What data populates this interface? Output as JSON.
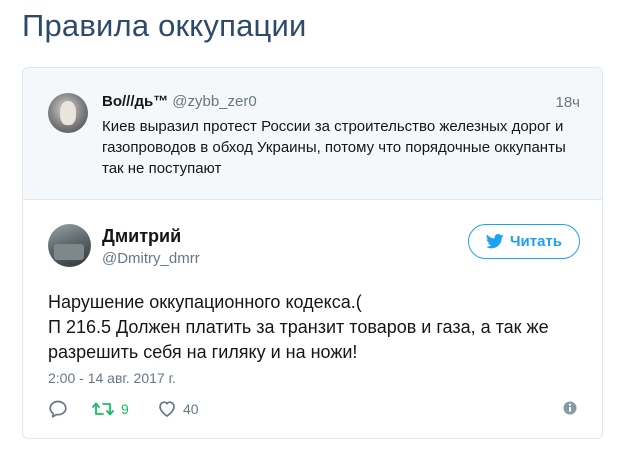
{
  "page": {
    "title": "Правила оккупации"
  },
  "quoted_tweet": {
    "author_name": "Во///дь™",
    "author_handle": "@zybb_zer0",
    "time": "18ч",
    "text": "Киев выразил протест России за строительство железных дорог и газопроводов в обход Украины, потому что порядочные оккупанты так не поступают"
  },
  "tweet": {
    "author_name": "Дмитрий",
    "author_handle": "@Dmitry_dmrr",
    "follow_label": "Читать",
    "text_lines": [
      "Нарушение оккупационного кодекса.(",
      "П 216.5 Должен платить за транзит товаров и газа, а так же",
      "разрешить себя на гиляку и на ножи!"
    ],
    "date": "2:00 - 14 авг. 2017 г.",
    "retweet_count": "9",
    "like_count": "40"
  },
  "colors": {
    "accent": "#1da1f2",
    "retweet": "#17bf63",
    "muted": "#657786",
    "title": "#2e4a6b"
  },
  "icons": [
    "twitter-bird-icon",
    "reply-icon",
    "retweet-icon",
    "heart-icon",
    "info-icon"
  ]
}
